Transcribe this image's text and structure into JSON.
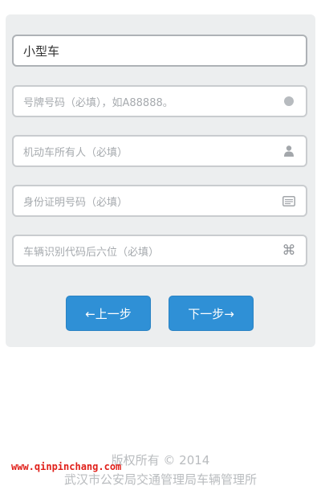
{
  "form": {
    "vehicle_type": {
      "value": "小型车",
      "icon": "none"
    },
    "plate_number": {
      "placeholder": "号牌号码（必填），如A88888。",
      "icon": "circle-dot-icon"
    },
    "owner": {
      "placeholder": "机动车所有人（必填）",
      "icon": "user-icon"
    },
    "id_number": {
      "placeholder": "身份证明号码（必填）",
      "icon": "id-card-icon"
    },
    "vin": {
      "placeholder": "车辆识别代码后六位（必填）",
      "icon": "command-icon"
    }
  },
  "buttons": {
    "prev_label": "←上一步",
    "next_label": "下一步→"
  },
  "footer": {
    "copyright": "版权所有 © 2014",
    "organization": "武汉市公安局交通管理局车辆管理所"
  },
  "watermark": {
    "text": "www.qinpinchang.com"
  },
  "colors": {
    "button": "#2f90d6",
    "card_background": "#eceeef",
    "watermark": "#e0201a"
  }
}
